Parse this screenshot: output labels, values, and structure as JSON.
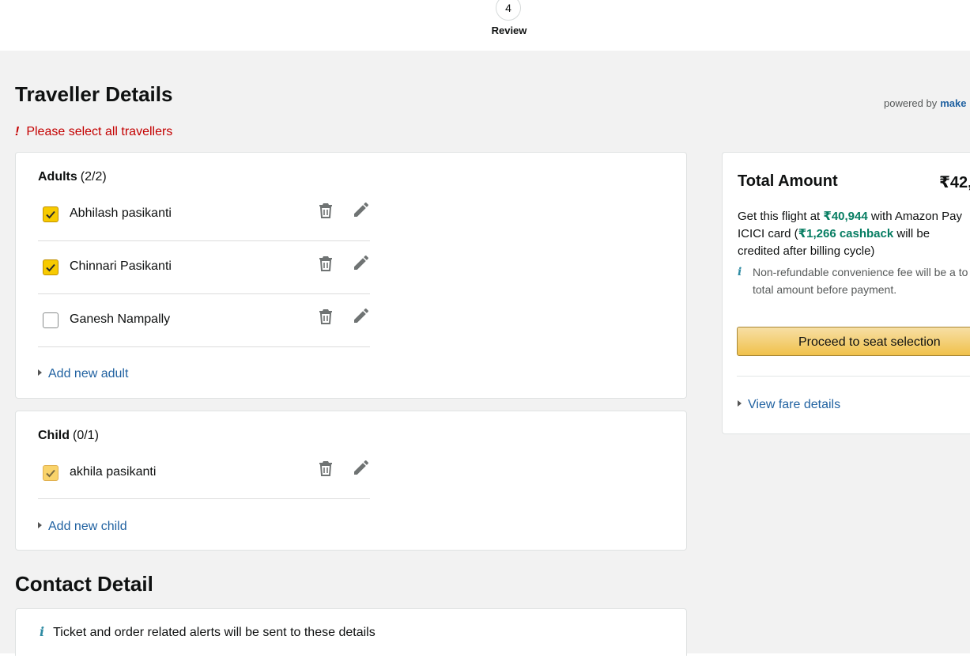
{
  "progress": {
    "step_number": "4",
    "step_label": "Review"
  },
  "page": {
    "title": "Traveller Details",
    "powered_by_prefix": "powered by",
    "powered_by_brand": "make",
    "error_icon": "!",
    "error_text": "Please select all travellers"
  },
  "adults": {
    "label": "Adults",
    "count": "(2/2)",
    "travellers": [
      {
        "name": "Abhilash pasikanti",
        "checked": true
      },
      {
        "name": "Chinnari Pasikanti",
        "checked": true
      },
      {
        "name": "Ganesh Nampally",
        "checked": false
      }
    ],
    "add_label": "Add new adult"
  },
  "child": {
    "label": "Child",
    "count": "(0/1)",
    "travellers": [
      {
        "name": "akhila pasikanti",
        "checked": true
      }
    ],
    "add_label": "Add new child"
  },
  "summary": {
    "title": "Total Amount",
    "amount": "₹42,",
    "offer_prefix": "Get this flight at ",
    "offer_price": "₹40,944",
    "offer_mid": " with Amazon Pay ICICI card (",
    "offer_cashback": "₹1,266 cashback",
    "offer_suffix": " will be credited after billing cycle)",
    "note_icon": "i",
    "note": "Non-refundable convenience fee will be a to total amount before payment.",
    "proceed_label": "Proceed to seat selection",
    "fare_link": "View fare details"
  },
  "contact": {
    "title": "Contact Detail",
    "info_icon": "i",
    "info": "Ticket and order related alerts will be sent to these details"
  },
  "colors": {
    "accent_yellow": "#f7ca00",
    "link_blue": "#2162a1",
    "error_red": "#c40000",
    "offer_green": "#067d62"
  },
  "icons": {
    "delete": "trash-icon",
    "edit": "pencil-icon",
    "check": "check-icon",
    "expand": "caret-right-icon",
    "info": "info-icon"
  }
}
